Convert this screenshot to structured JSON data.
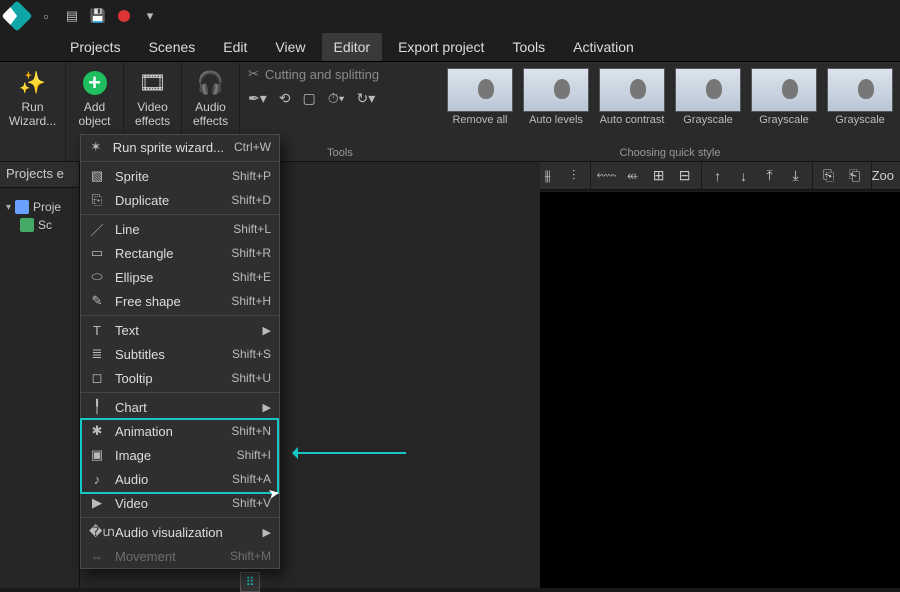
{
  "menubar": [
    "Projects",
    "Scenes",
    "Edit",
    "View",
    "Editor",
    "Export project",
    "Tools",
    "Activation"
  ],
  "active_menu": "Editor",
  "ribbon": {
    "run_wizard": "Run\nWizard...",
    "add_object": "Add\nobject",
    "video_effects": "Video\neffects",
    "audio_effects": "Audio\neffects",
    "cutting_label": "Cutting and splitting",
    "tools_label": "Tools",
    "style_label": "Choosing quick style",
    "thumbs": [
      "Remove all",
      "Auto levels",
      "Auto contrast",
      "Grayscale",
      "Grayscale",
      "Grayscale"
    ]
  },
  "left_panel_title": "Projects e",
  "tree": {
    "root": "Proje",
    "child": "Sc"
  },
  "toolbar_right": "Zoo",
  "dropdown": [
    {
      "icon": "✶",
      "label": "Run sprite wizard...",
      "shortcut": "Ctrl+W"
    },
    {
      "sep": true
    },
    {
      "icon": "▧",
      "label": "Sprite",
      "shortcut": "Shift+P"
    },
    {
      "icon": "⎘",
      "label": "Duplicate",
      "shortcut": "Shift+D"
    },
    {
      "sep": true
    },
    {
      "icon": "／",
      "label": "Line",
      "shortcut": "Shift+L"
    },
    {
      "icon": "▭",
      "label": "Rectangle",
      "shortcut": "Shift+R"
    },
    {
      "icon": "⬭",
      "label": "Ellipse",
      "shortcut": "Shift+E"
    },
    {
      "icon": "✎",
      "label": "Free shape",
      "shortcut": "Shift+H"
    },
    {
      "sep": true
    },
    {
      "icon": "T",
      "label": "Text",
      "submenu": true
    },
    {
      "icon": "≣",
      "label": "Subtitles",
      "shortcut": "Shift+S"
    },
    {
      "icon": "◻",
      "label": "Tooltip",
      "shortcut": "Shift+U"
    },
    {
      "sep": true
    },
    {
      "icon": "╿",
      "label": "Chart",
      "submenu": true
    },
    {
      "icon": "✱",
      "label": "Animation",
      "shortcut": "Shift+N"
    },
    {
      "icon": "▣",
      "label": "Image",
      "shortcut": "Shift+I"
    },
    {
      "icon": "♪",
      "label": "Audio",
      "shortcut": "Shift+A"
    },
    {
      "icon": "▶",
      "label": "Video",
      "shortcut": "Shift+V"
    },
    {
      "sep": true
    },
    {
      "icon": "�տ",
      "label": "Audio visualization",
      "submenu": true
    },
    {
      "icon": "⇔",
      "label": "Movement",
      "shortcut": "Shift+M",
      "disabled": true
    }
  ]
}
